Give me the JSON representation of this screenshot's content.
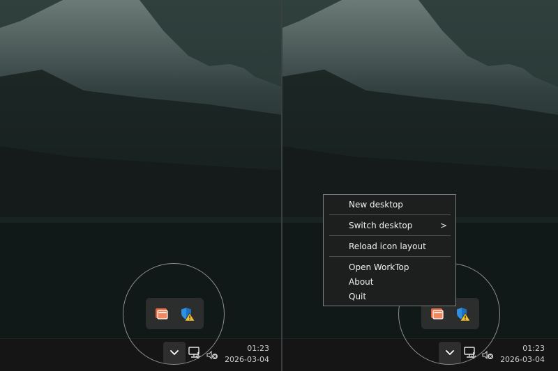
{
  "panes": [
    {
      "id": "before",
      "clock": {
        "time": "01:23",
        "date": "2026-03-04"
      }
    },
    {
      "id": "after",
      "clock": {
        "time": "01:23",
        "date": "2026-03-04"
      }
    }
  ],
  "tray": {
    "icons": [
      "worktop-app-icon",
      "security-shield-warning-icon"
    ],
    "overflow_icon": "chevron-down-icon",
    "network_icon": "network-monitor-icon",
    "volume_icon": "speaker-muted-icon"
  },
  "context_menu": {
    "items": [
      {
        "label": "New desktop"
      },
      {
        "label": "Switch desktop",
        "submenu_arrow": ">"
      },
      {
        "label": "Reload icon layout"
      },
      {
        "label": "Open WorkTop"
      },
      {
        "label": "About"
      },
      {
        "label": "Quit"
      }
    ]
  },
  "colors": {
    "menu_bg": "#1d1f1f",
    "menu_border": "#7a7f7e",
    "taskbar": "#151515",
    "worktop_orange": "#e8663a",
    "shield_blue": "#2f8fe0",
    "warning_yellow": "#f2c12e"
  }
}
